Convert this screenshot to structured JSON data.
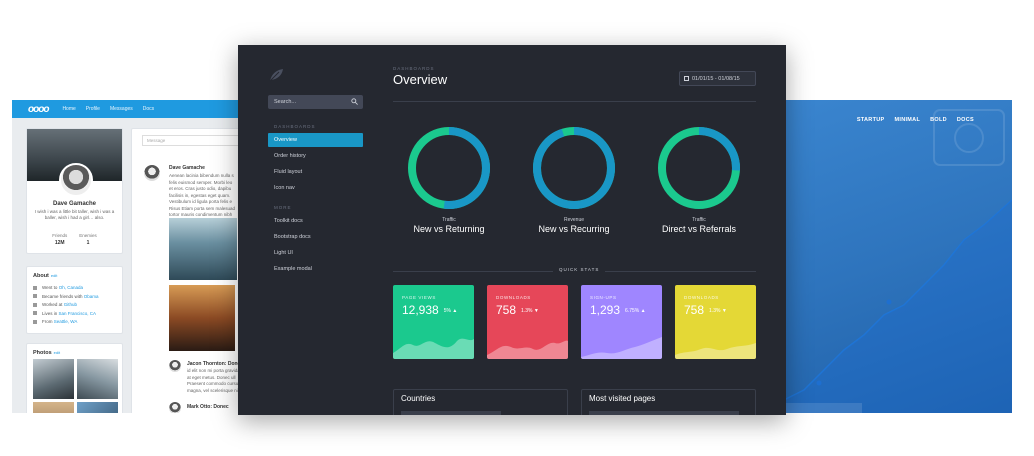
{
  "social": {
    "brand": "oooo",
    "nav": [
      "Home",
      "Profile",
      "Messages",
      "Docs"
    ],
    "profile": {
      "name": "Dave Gamache",
      "bio": "I wish i was a little bit taller, wish i was a baller, wish i had a girl… also.",
      "stats": [
        {
          "label": "Friends",
          "value": "12M"
        },
        {
          "label": "Enemies",
          "value": "1"
        }
      ]
    },
    "about": {
      "title": "About",
      "edit": "edit",
      "items": [
        {
          "text": "Went to ",
          "link": "Oh, Canada"
        },
        {
          "text": "Became friends with ",
          "link": "Obama"
        },
        {
          "text": "Worked at ",
          "link": "Github"
        },
        {
          "text": "Lives in ",
          "link": "San Francisco, CA"
        },
        {
          "text": "From ",
          "link": "Seattle, WA"
        }
      ]
    },
    "photos": {
      "title": "Photos",
      "edit": "edit"
    },
    "feed": {
      "message_placeholder": "Message",
      "post1": {
        "name": "Dave Gamache",
        "text": "Aenean lacinia bibendum nulla s\nfelis euismod semper. Morbi leo\net eros. Cras justo odio, dapibu\nfacilisis in, egestas eget quam.\nVestibulum id ligula porta felis e\nRisus Etiam porta sem malesuad\ntortor mauris condimentum nibh"
      },
      "post2": {
        "name": "Jacon Thornton: Donec",
        "text": "id elit non mi porta gravida\nat eget metus. Donec ull\nPraesent commodo cursus\nmagna, vel scelerisque nisl"
      },
      "post3": {
        "name": "Mark Otto: Donec"
      }
    }
  },
  "dashboard": {
    "sidebar": {
      "search_placeholder": "Search...",
      "section1": "DASHBOARDS",
      "items1": [
        "Overview",
        "Order history",
        "Fluid layout",
        "Icon nav"
      ],
      "section2": "MORE",
      "items2": [
        "Toolkit docs",
        "Bootstrap docs",
        "Light UI",
        "Example modal"
      ]
    },
    "eyebrow": "DASHBOARDS",
    "title": "Overview",
    "date_range": "01/01/15 - 01/08/15",
    "donuts": [
      {
        "caption": "Traffic",
        "label": "New vs Returning",
        "primary_fraction": 0.52
      },
      {
        "caption": "Revenue",
        "label": "New vs Recurring",
        "primary_fraction": 0.95
      },
      {
        "caption": "Traffic",
        "label": "Direct vs Referrals",
        "primary_fraction": 0.26
      }
    ],
    "quick_stats_label": "QUICK STATS",
    "stats": [
      {
        "label": "PAGE VIEWS",
        "value": "12,938",
        "delta": "5% ▲",
        "color": "#1bc98e"
      },
      {
        "label": "DOWNLOADS",
        "value": "758",
        "delta": "1.3% ▼",
        "color": "#e64759"
      },
      {
        "label": "SIGN-UPS",
        "value": "1,293",
        "delta": "6.75% ▲",
        "color": "#9f86ff"
      },
      {
        "label": "DOWNLOADS",
        "value": "758",
        "delta": "1.3% ▼",
        "color": "#e4d836"
      }
    ],
    "panels": [
      "Countries",
      "Most visited pages"
    ],
    "colors": {
      "blue": "#1997c6",
      "green": "#1bc98e"
    }
  },
  "landing": {
    "nav": [
      "STARTUP",
      "MINIMAL",
      "BOLD",
      "DOCS"
    ]
  }
}
